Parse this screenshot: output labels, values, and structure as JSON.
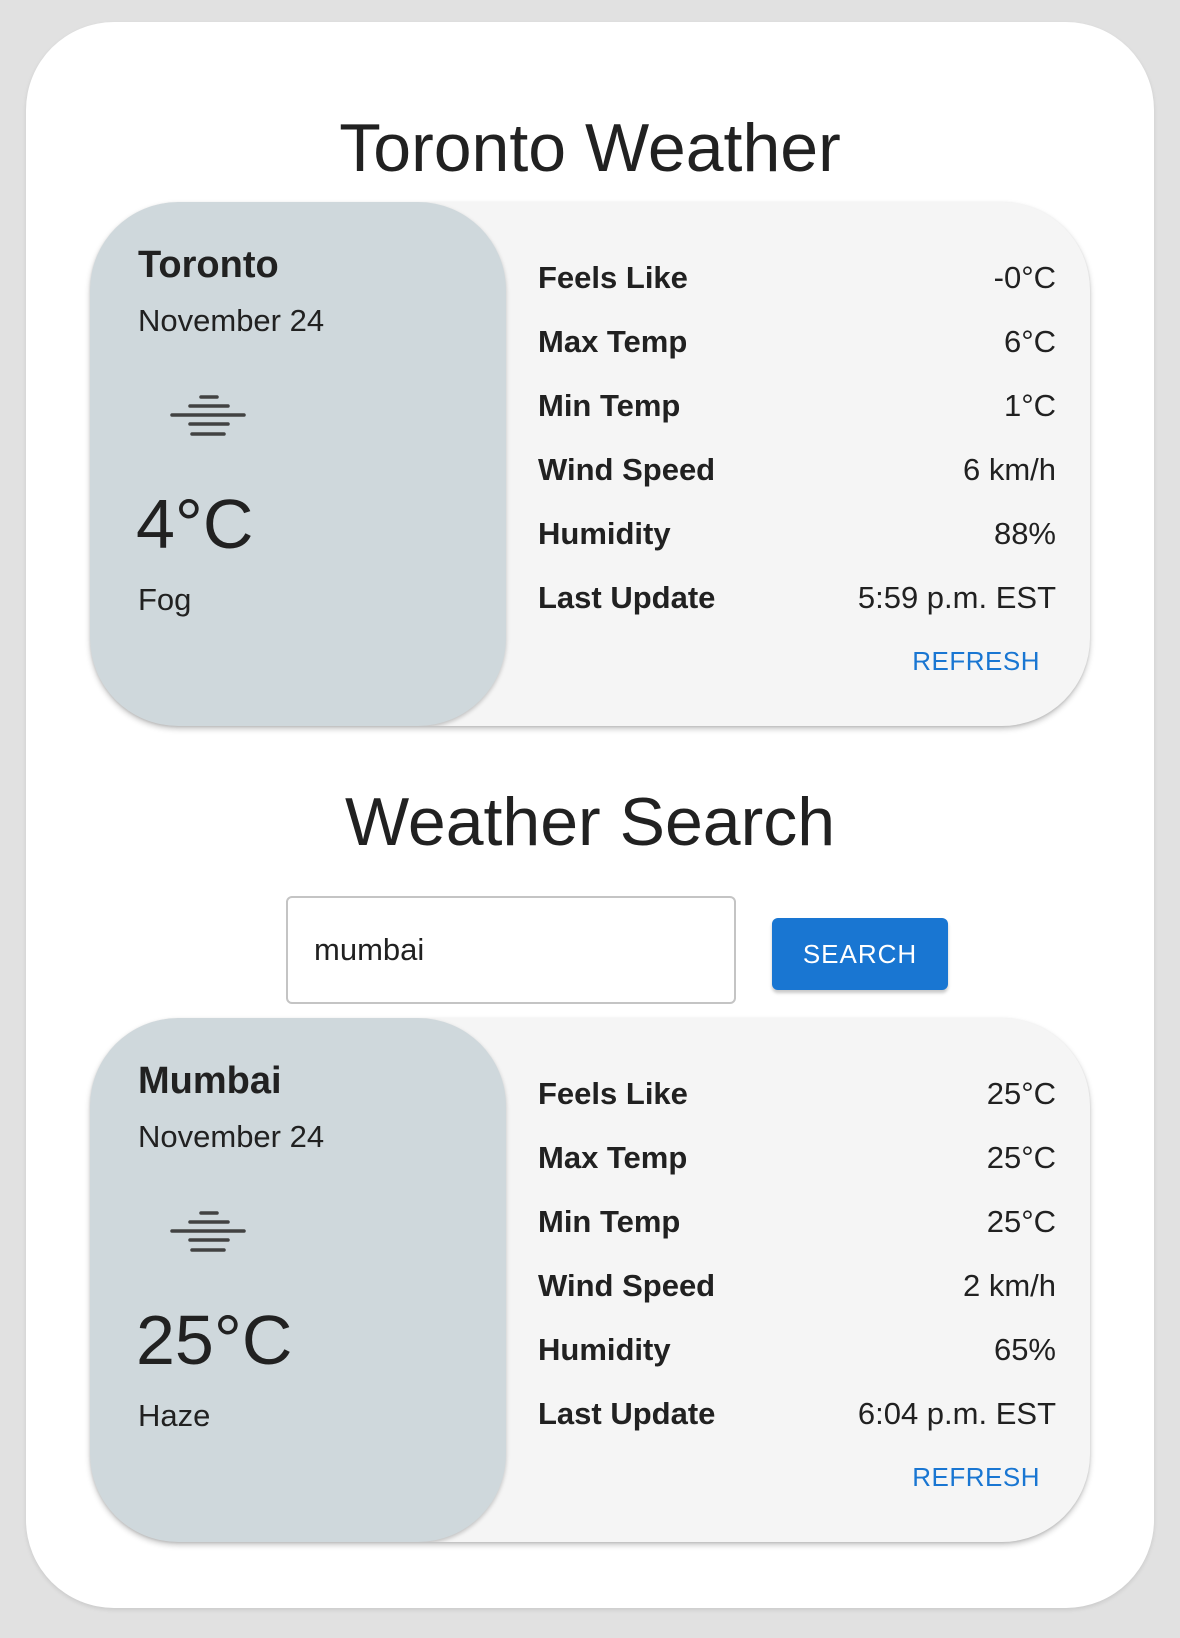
{
  "current": {
    "title": "Toronto Weather",
    "city": "Toronto",
    "date": "November 24",
    "icon": "fog-icon",
    "temperature": "4°C",
    "condition": "Fog",
    "details": [
      {
        "label": "Feels Like",
        "value": "-0°C"
      },
      {
        "label": "Max Temp",
        "value": "6°C"
      },
      {
        "label": "Min Temp",
        "value": "1°C"
      },
      {
        "label": "Wind Speed",
        "value": "6 km/h"
      },
      {
        "label": "Humidity",
        "value": "88%"
      },
      {
        "label": "Last Update",
        "value": "5:59 p.m. EST"
      }
    ],
    "refresh_label": "REFRESH"
  },
  "search": {
    "title": "Weather Search",
    "value": "mumbai",
    "button_label": "SEARCH"
  },
  "result": {
    "city": "Mumbai",
    "date": "November 24",
    "icon": "haze-icon",
    "temperature": "25°C",
    "condition": "Haze",
    "details": [
      {
        "label": "Feels Like",
        "value": "25°C"
      },
      {
        "label": "Max Temp",
        "value": "25°C"
      },
      {
        "label": "Min Temp",
        "value": "25°C"
      },
      {
        "label": "Wind Speed",
        "value": "2 km/h"
      },
      {
        "label": "Humidity",
        "value": "65%"
      },
      {
        "label": "Last Update",
        "value": "6:04 p.m. EST"
      }
    ],
    "refresh_label": "REFRESH"
  },
  "colors": {
    "accent": "#1976d2",
    "card_left": "#cfd8dc",
    "card_right": "#f5f5f5",
    "background": "#e1e1e1"
  }
}
